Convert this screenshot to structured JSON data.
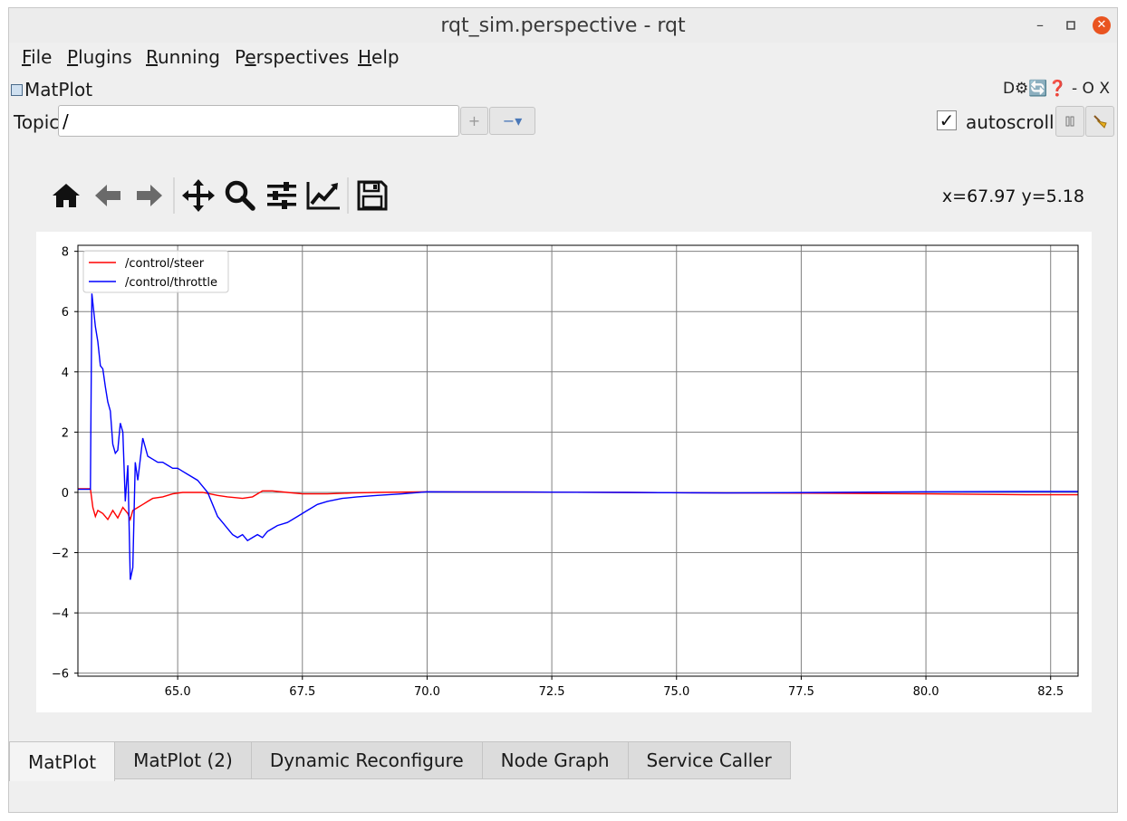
{
  "window": {
    "title": "rqt_sim.perspective - rqt",
    "minimize": "–",
    "maximize": "▫",
    "close": "✕"
  },
  "menu": [
    {
      "ul": "F",
      "rest": "ile"
    },
    {
      "ul": "P",
      "rest": "lugins"
    },
    {
      "ul": "R",
      "rest": "unning"
    },
    {
      "ul": "",
      "pre": "P",
      "ul2": "e",
      "rest": "rspectives"
    },
    {
      "ul": "H",
      "rest": "elp"
    }
  ],
  "plugin": {
    "title": "MatPlot",
    "controls": "D⚙🔄❓ - O X"
  },
  "topic": {
    "label": "Topic",
    "value": "/",
    "add": "+",
    "remove": "−▾"
  },
  "autoscroll": {
    "label": "autoscroll",
    "checked": "✓"
  },
  "coords": "x=67.97 y=5.18",
  "tabs": [
    "MatPlot",
    "MatPlot (2)",
    "Dynamic Reconfigure",
    "Node Graph",
    "Service Caller"
  ],
  "chart_data": {
    "type": "line",
    "xlim": [
      63.0,
      83.05
    ],
    "ylim": [
      -6.1,
      8.2
    ],
    "xticks": [
      65.0,
      67.5,
      70.0,
      72.5,
      75.0,
      77.5,
      80.0,
      82.5
    ],
    "yticks": [
      -6,
      -4,
      -2,
      0,
      2,
      4,
      6,
      8
    ],
    "grid": true,
    "legend_position": "top-left",
    "series": [
      {
        "name": "/control/steer",
        "color": "#ff0000",
        "points": [
          [
            63.0,
            0.12
          ],
          [
            63.25,
            0.12
          ],
          [
            63.3,
            -0.5
          ],
          [
            63.35,
            -0.8
          ],
          [
            63.4,
            -0.6
          ],
          [
            63.5,
            -0.7
          ],
          [
            63.6,
            -0.9
          ],
          [
            63.7,
            -0.6
          ],
          [
            63.8,
            -0.85
          ],
          [
            63.9,
            -0.5
          ],
          [
            64.0,
            -0.7
          ],
          [
            64.05,
            -0.9
          ],
          [
            64.1,
            -0.6
          ],
          [
            64.2,
            -0.5
          ],
          [
            64.3,
            -0.4
          ],
          [
            64.4,
            -0.3
          ],
          [
            64.5,
            -0.2
          ],
          [
            64.7,
            -0.15
          ],
          [
            64.9,
            -0.05
          ],
          [
            65.1,
            0.0
          ],
          [
            65.3,
            0.0
          ],
          [
            65.5,
            0.0
          ],
          [
            65.8,
            -0.1
          ],
          [
            66.0,
            -0.15
          ],
          [
            66.3,
            -0.2
          ],
          [
            66.5,
            -0.15
          ],
          [
            66.7,
            0.05
          ],
          [
            66.9,
            0.05
          ],
          [
            67.2,
            0.0
          ],
          [
            67.5,
            -0.05
          ],
          [
            68.0,
            -0.05
          ],
          [
            68.5,
            -0.02
          ],
          [
            69.0,
            0.0
          ],
          [
            70.0,
            0.02
          ],
          [
            72.0,
            0.01
          ],
          [
            74.0,
            0.0
          ],
          [
            76.0,
            -0.02
          ],
          [
            78.0,
            -0.03
          ],
          [
            80.0,
            -0.05
          ],
          [
            82.0,
            -0.08
          ],
          [
            83.05,
            -0.08
          ]
        ]
      },
      {
        "name": "/control/throttle",
        "color": "#0000ff",
        "points": [
          [
            63.0,
            0.1
          ],
          [
            63.25,
            0.1
          ],
          [
            63.28,
            6.6
          ],
          [
            63.35,
            5.5
          ],
          [
            63.4,
            5.0
          ],
          [
            63.45,
            4.2
          ],
          [
            63.5,
            4.1
          ],
          [
            63.55,
            3.5
          ],
          [
            63.6,
            3.0
          ],
          [
            63.65,
            2.7
          ],
          [
            63.7,
            1.6
          ],
          [
            63.75,
            1.3
          ],
          [
            63.8,
            1.4
          ],
          [
            63.85,
            2.3
          ],
          [
            63.9,
            2.0
          ],
          [
            63.95,
            -0.3
          ],
          [
            64.0,
            0.9
          ],
          [
            64.05,
            -2.9
          ],
          [
            64.1,
            -2.5
          ],
          [
            64.15,
            1.0
          ],
          [
            64.2,
            0.4
          ],
          [
            64.3,
            1.8
          ],
          [
            64.4,
            1.2
          ],
          [
            64.5,
            1.1
          ],
          [
            64.6,
            1.0
          ],
          [
            64.7,
            1.0
          ],
          [
            64.8,
            0.9
          ],
          [
            64.9,
            0.8
          ],
          [
            65.0,
            0.8
          ],
          [
            65.1,
            0.7
          ],
          [
            65.2,
            0.6
          ],
          [
            65.4,
            0.4
          ],
          [
            65.5,
            0.2
          ],
          [
            65.6,
            0.0
          ],
          [
            65.7,
            -0.4
          ],
          [
            65.8,
            -0.8
          ],
          [
            65.9,
            -1.0
          ],
          [
            66.0,
            -1.2
          ],
          [
            66.1,
            -1.4
          ],
          [
            66.2,
            -1.5
          ],
          [
            66.3,
            -1.4
          ],
          [
            66.4,
            -1.6
          ],
          [
            66.5,
            -1.5
          ],
          [
            66.6,
            -1.4
          ],
          [
            66.7,
            -1.5
          ],
          [
            66.8,
            -1.3
          ],
          [
            66.9,
            -1.2
          ],
          [
            67.0,
            -1.1
          ],
          [
            67.2,
            -1.0
          ],
          [
            67.4,
            -0.8
          ],
          [
            67.6,
            -0.6
          ],
          [
            67.8,
            -0.4
          ],
          [
            68.0,
            -0.3
          ],
          [
            68.3,
            -0.2
          ],
          [
            68.6,
            -0.15
          ],
          [
            69.0,
            -0.1
          ],
          [
            69.5,
            -0.05
          ],
          [
            70.0,
            0.02
          ],
          [
            72.0,
            0.01
          ],
          [
            74.0,
            0.0
          ],
          [
            76.0,
            -0.02
          ],
          [
            78.0,
            0.0
          ],
          [
            80.0,
            0.02
          ],
          [
            82.0,
            0.03
          ],
          [
            83.05,
            0.03
          ]
        ]
      }
    ]
  }
}
